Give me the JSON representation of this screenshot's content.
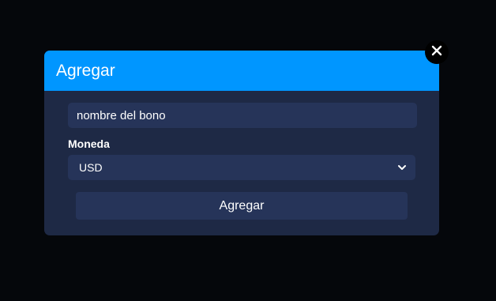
{
  "modal": {
    "title": "Agregar",
    "name_field": {
      "value": "",
      "placeholder": "nombre del bono"
    },
    "currency": {
      "label": "Moneda",
      "selected": "USD"
    },
    "submit_label": "Agregar",
    "close_icon": "close-icon"
  },
  "colors": {
    "backdrop": "#05070b",
    "header": "#0096ff",
    "modal_body": "#1e2945",
    "field_bg": "#263459",
    "text": "#ffffff"
  }
}
